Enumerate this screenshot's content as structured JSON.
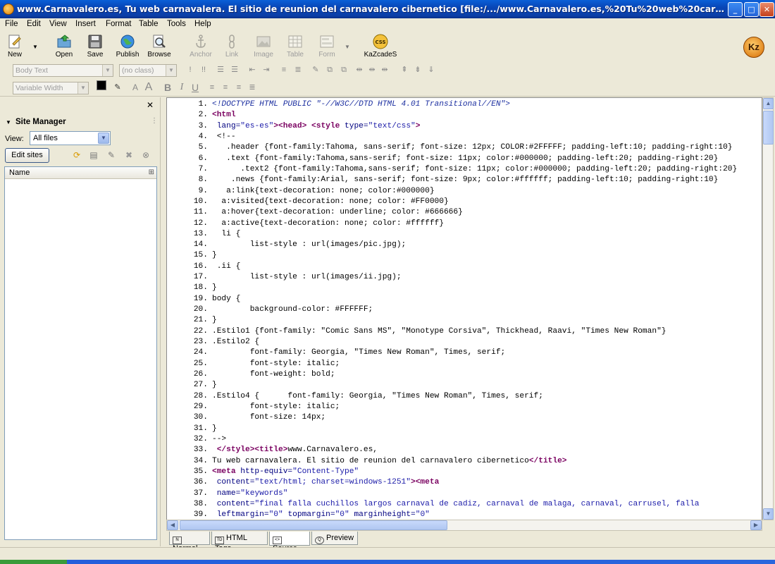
{
  "window": {
    "title": "www.Carnavalero.es, Tu web carnavalera. El sitio de reunion del carnavalero cibernetico [file:/.../www.Carnavalero.es,%20Tu%20web%20carnavalera.%20El%20sitio%...",
    "minimize": "_",
    "maximize": "□",
    "close": "✕"
  },
  "menu": [
    "File",
    "Edit",
    "View",
    "Insert",
    "Format",
    "Table",
    "Tools",
    "Help"
  ],
  "toolbar": {
    "new": "New",
    "open": "Open",
    "save": "Save",
    "publish": "Publish",
    "browse": "Browse",
    "anchor": "Anchor",
    "link": "Link",
    "image": "Image",
    "table": "Table",
    "form": "Form",
    "kazcades": "KaZcadeS",
    "logo": "Kz"
  },
  "format_bar": {
    "paragraph_style": "Body Text",
    "class": "(no class)",
    "font": "Variable Width"
  },
  "site_manager": {
    "title": "Site Manager",
    "view_label": "View:",
    "view_value": "All files",
    "edit_sites": "Edit sites",
    "column_name": "Name"
  },
  "editor": {
    "lines": [
      [
        [
          "c",
          "<!DOCTYPE HTML PUBLIC \"-//W3C//DTD HTML 4.01 Transitional//EN\">"
        ]
      ],
      [
        [
          "t",
          "<html"
        ]
      ],
      [
        [
          "a",
          " lang="
        ],
        [
          "v",
          "\"es-es\""
        ],
        [
          "t",
          "><head>"
        ],
        [
          "k",
          " "
        ],
        [
          "t",
          "<style"
        ],
        [
          "a",
          " type="
        ],
        [
          "v",
          "\"text/css\""
        ],
        [
          "t",
          ">"
        ]
      ],
      [
        [
          "k",
          " <!--"
        ]
      ],
      [
        [
          "k",
          "   .header {font-family:Tahoma, sans-serif; font-size: 12px; COLOR:#2FFFFF; padding-left:10; padding-right:10}"
        ]
      ],
      [
        [
          "k",
          "   .text {font-family:Tahoma,sans-serif; font-size: 11px; color:#000000; padding-left:20; padding-right:20}"
        ]
      ],
      [
        [
          "k",
          "      .text2 {font-family:Tahoma,sans-serif; font-size: 11px; color:#000000; padding-left:20; padding-right:20}"
        ]
      ],
      [
        [
          "k",
          "    .news {font-family:Arial, sans-serif; font-size: 9px; color:#ffffff; padding-left:10; padding-right:10}"
        ]
      ],
      [
        [
          "k",
          "   a:link{text-decoration: none; color:#000000}"
        ]
      ],
      [
        [
          "k",
          "  a:visited{text-decoration: none; color: #FF0000}"
        ]
      ],
      [
        [
          "k",
          "  a:hover{text-decoration: underline; color: #666666}"
        ]
      ],
      [
        [
          "k",
          "  a:active{text-decoration: none; color: #ffffff}"
        ]
      ],
      [
        [
          "k",
          "  li {"
        ]
      ],
      [
        [
          "k",
          "        list-style : url(images/pic.jpg);"
        ]
      ],
      [
        [
          "k",
          "}"
        ]
      ],
      [
        [
          "k",
          " .ii {"
        ]
      ],
      [
        [
          "k",
          "        list-style : url(images/ii.jpg);"
        ]
      ],
      [
        [
          "k",
          "}"
        ]
      ],
      [
        [
          "k",
          "body {"
        ]
      ],
      [
        [
          "k",
          "        background-color: #FFFFFF;"
        ]
      ],
      [
        [
          "k",
          "}"
        ]
      ],
      [
        [
          "k",
          ".Estilo1 {font-family: \"Comic Sans MS\", \"Monotype Corsiva\", Thickhead, Raavi, \"Times New Roman\"}"
        ]
      ],
      [
        [
          "k",
          ".Estilo2 {"
        ]
      ],
      [
        [
          "k",
          "        font-family: Georgia, \"Times New Roman\", Times, serif;"
        ]
      ],
      [
        [
          "k",
          "        font-style: italic;"
        ]
      ],
      [
        [
          "k",
          "        font-weight: bold;"
        ]
      ],
      [
        [
          "k",
          "}"
        ]
      ],
      [
        [
          "k",
          ".Estilo4 {      font-family: Georgia, \"Times New Roman\", Times, serif;"
        ]
      ],
      [
        [
          "k",
          "        font-style: italic;"
        ]
      ],
      [
        [
          "k",
          "        font-size: 14px;"
        ]
      ],
      [
        [
          "k",
          "}"
        ]
      ],
      [
        [
          "k",
          "-->"
        ]
      ],
      [
        [
          "k",
          " "
        ],
        [
          "t",
          "</style><title>"
        ],
        [
          "k",
          "www.Carnavalero.es,"
        ]
      ],
      [
        [
          "k",
          "Tu web carnavalera. El sitio de reunion del carnavalero cibernetico"
        ],
        [
          "t",
          "</title>"
        ]
      ],
      [
        [
          "t",
          "<meta"
        ],
        [
          "a",
          " http-equiv="
        ],
        [
          "v",
          "\"Content-Type\""
        ]
      ],
      [
        [
          "a",
          " content="
        ],
        [
          "v",
          "\"text/html; charset=windows-1251\""
        ],
        [
          "t",
          "><meta"
        ]
      ],
      [
        [
          "a",
          " name="
        ],
        [
          "v",
          "\"keywords\""
        ]
      ],
      [
        [
          "a",
          " content="
        ],
        [
          "v",
          "\"final falla cuchillos largos carnaval de cadiz, carnaval de malaga, carnaval, carrusel, falla"
        ]
      ],
      [
        [
          "a",
          " leftmargin="
        ],
        [
          "v",
          "\"0\""
        ],
        [
          "a",
          " topmargin="
        ],
        [
          "v",
          "\"0\""
        ],
        [
          "a",
          " marginheight="
        ],
        [
          "v",
          "\"0\""
        ]
      ]
    ]
  },
  "tabs": [
    "Normal",
    "HTML Tags",
    "Source",
    "Preview"
  ],
  "tab_icons": [
    "N",
    "TD",
    "<>",
    "Q"
  ],
  "active_tab": "Source"
}
